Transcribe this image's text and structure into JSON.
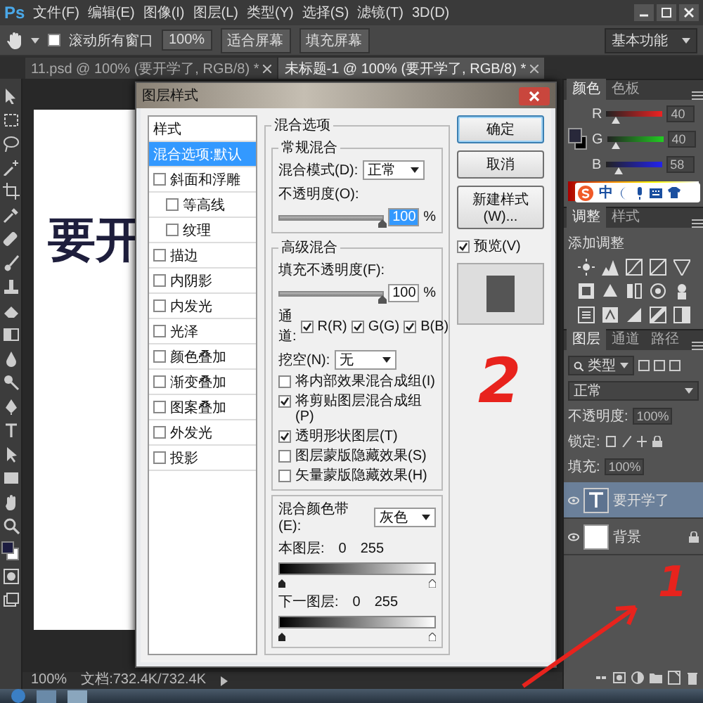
{
  "menu_bar": {
    "logo": "Ps",
    "items": [
      "文件(F)",
      "编辑(E)",
      "图像(I)",
      "图层(L)",
      "类型(Y)",
      "选择(S)",
      "滤镜(T)",
      "3D(D)"
    ]
  },
  "options_bar": {
    "scroll_all": {
      "label": "滚动所有窗口",
      "checked": false
    },
    "buttons": [
      "100%",
      "适合屏幕",
      "填充屏幕"
    ],
    "workspace": "基本功能"
  },
  "doc_tabs": [
    {
      "label": "11.psd @ 100% (要开学了, RGB/8) *",
      "selected": false
    },
    {
      "label": "未标题-1 @ 100% (要开学了, RGB/8) *",
      "selected": true
    }
  ],
  "document": {
    "text": "要开"
  },
  "dialog": {
    "title": "图层样式",
    "styles": [
      {
        "label": "样式",
        "kind": "header",
        "selected": false
      },
      {
        "label": "混合选项:默认",
        "kind": "header",
        "selected": true
      },
      {
        "label": "斜面和浮雕",
        "kind": "check",
        "checked": false,
        "selected": false
      },
      {
        "label": "等高线",
        "kind": "subcheck",
        "checked": false,
        "selected": false
      },
      {
        "label": "纹理",
        "kind": "subcheck",
        "checked": false,
        "selected": false
      },
      {
        "label": "描边",
        "kind": "check",
        "checked": false,
        "selected": false
      },
      {
        "label": "内阴影",
        "kind": "check",
        "checked": false,
        "selected": false
      },
      {
        "label": "内发光",
        "kind": "check",
        "checked": false,
        "selected": false
      },
      {
        "label": "光泽",
        "kind": "check",
        "checked": false,
        "selected": false
      },
      {
        "label": "颜色叠加",
        "kind": "check",
        "checked": false,
        "selected": false
      },
      {
        "label": "渐变叠加",
        "kind": "check",
        "checked": false,
        "selected": false
      },
      {
        "label": "图案叠加",
        "kind": "check",
        "checked": false,
        "selected": false
      },
      {
        "label": "外发光",
        "kind": "check",
        "checked": false,
        "selected": false
      },
      {
        "label": "投影",
        "kind": "check",
        "checked": false,
        "selected": false
      }
    ],
    "section_title": "混合选项",
    "general": {
      "title": "常规混合",
      "mode_label": "混合模式(D):",
      "mode": "正常",
      "opacity_label": "不透明度(O):",
      "opacity": {
        "level": 1,
        "value": "100",
        "unit": "%"
      }
    },
    "advanced": {
      "title": "高级混合",
      "fill_label": "填充不透明度(F):",
      "fill": {
        "level": 1,
        "value": "100",
        "unit": "%"
      },
      "channels_label": "通道:",
      "channels": [
        {
          "label": "R(R)",
          "checked": true
        },
        {
          "label": "G(G)",
          "checked": true
        },
        {
          "label": "B(B)",
          "checked": true
        }
      ],
      "knockout_label": "挖空(N):",
      "knockout": "无",
      "options": [
        {
          "label": "将内部效果混合成组(I)",
          "checked": false
        },
        {
          "label": "将剪贴图层混合成组(P)",
          "checked": true
        },
        {
          "label": "透明形状图层(T)",
          "checked": true
        },
        {
          "label": "图层蒙版隐藏效果(S)",
          "checked": false
        },
        {
          "label": "矢量蒙版隐藏效果(H)",
          "checked": false
        }
      ]
    },
    "blend_if": {
      "label": "混合颜色带(E):",
      "value": "灰色",
      "ranges": [
        {
          "label": "本图层:",
          "min": "0",
          "max": "255"
        },
        {
          "label": "下一图层:",
          "min": "0",
          "max": "255"
        }
      ]
    },
    "buttons": [
      {
        "label": "确定",
        "kind": "primary"
      },
      {
        "label": "取消",
        "kind": "normal"
      },
      {
        "label": "新建样式(W)...",
        "kind": "normal"
      }
    ],
    "preview": {
      "label": "预览(V)",
      "checked": true
    }
  },
  "color_panel": {
    "tabs": [
      {
        "label": "颜色",
        "selected": true
      },
      {
        "label": "色板",
        "selected": false
      }
    ],
    "sliders": [
      {
        "channel": "R",
        "level": 0.16,
        "value": "40"
      },
      {
        "channel": "G",
        "level": 0.16,
        "value": "40"
      },
      {
        "channel": "B",
        "level": 0.23,
        "value": "58"
      }
    ]
  },
  "ime_bar": {
    "mode": "中"
  },
  "adjustments_panel": {
    "tabs": [
      {
        "label": "调整",
        "selected": true
      },
      {
        "label": "样式",
        "selected": false
      }
    ],
    "title": "添加调整"
  },
  "layers_panel": {
    "tabs": [
      {
        "label": "图层",
        "selected": true
      },
      {
        "label": "通道",
        "selected": false
      },
      {
        "label": "路径",
        "selected": false
      }
    ],
    "filter": "类型",
    "mode": "正常",
    "opacity_label": "不透明度:",
    "opacity": "100%",
    "lock_label": "锁定:",
    "fill_label": "填充:",
    "fill": "100%",
    "layers": [
      {
        "name": "要开学了",
        "kind": "text",
        "selected": true,
        "visible": true
      },
      {
        "name": "背景",
        "kind": "background",
        "selected": false,
        "visible": true
      }
    ]
  },
  "status_bar": {
    "zoom": "100%",
    "doc_info": "文档:732.4K/732.4K"
  },
  "annotations": [
    {
      "text": "2"
    },
    {
      "text": "1"
    }
  ]
}
